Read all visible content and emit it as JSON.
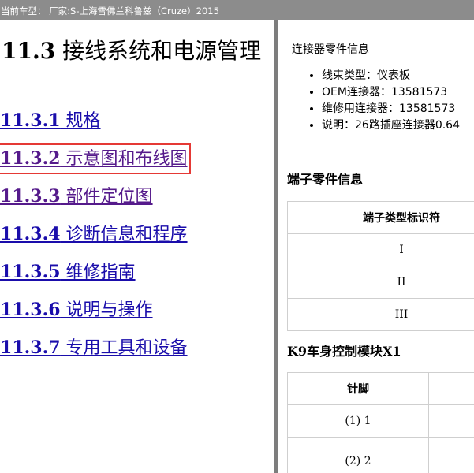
{
  "topbar": {
    "text": "当前车型： 厂家:S-上海雪佛兰科鲁兹（Cruze）2015"
  },
  "left": {
    "title_number": "11.3",
    "title_text": " 接线系统和电源管理",
    "toc": [
      {
        "number": "11.3.1",
        "label": " 规格"
      },
      {
        "number": "11.3.2",
        "label": " 示意图和布线图"
      },
      {
        "number": "11.3.3",
        "label": " 部件定位图"
      },
      {
        "number": "11.3.4",
        "label": " 诊断信息和程序"
      },
      {
        "number": "11.3.5",
        "label": " 维修指南"
      },
      {
        "number": "11.3.6",
        "label": " 说明与操作"
      },
      {
        "number": "11.3.7",
        "label": " 专用工具和设备"
      }
    ]
  },
  "right": {
    "connector_heading": "连接器零件信息",
    "bullets": [
      "线束类型：仪表板",
      "OEM连接器：13581573",
      "维修用连接器：13581573",
      "说明：26路插座连接器0.64"
    ],
    "terminal_heading": "端子零件信息",
    "terminal_table": {
      "header": "端子类型标识符",
      "rows": [
        "I",
        "II",
        "III"
      ]
    },
    "k9_heading": "K9车身控制模块X1",
    "k9_table": {
      "header": "针脚",
      "rows": [
        "(1) 1",
        "(2) 2"
      ]
    }
  },
  "colors": {
    "link": "#1a0dab",
    "visited": "#551a8b",
    "highlight": "#e53935",
    "topbar": "#8c8c8c"
  }
}
